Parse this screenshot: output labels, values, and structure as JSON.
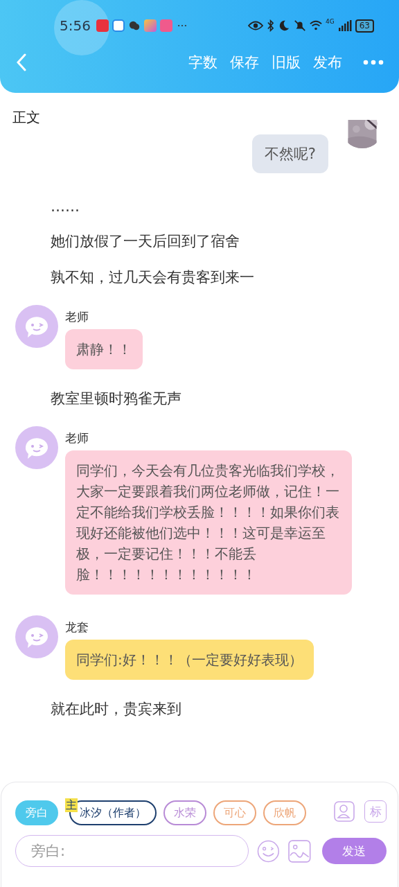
{
  "status_bar": {
    "time": "5:56",
    "network": "4G",
    "battery": "63"
  },
  "toolbar": {
    "actions": [
      "字数",
      "保存",
      "旧版",
      "发布"
    ]
  },
  "section_title": "正文",
  "blocks": [
    {
      "kind": "own_message",
      "text": "不然呢?",
      "color": "#e1e6ef"
    },
    {
      "kind": "narration",
      "text": "……"
    },
    {
      "kind": "narration",
      "text": "她们放假了一天后回到了宿舍"
    },
    {
      "kind": "narration",
      "text": "孰不知，过几天会有贵客到来一"
    },
    {
      "kind": "message",
      "name": "老师",
      "text": "肃静！！",
      "color": "#fdd0db"
    },
    {
      "kind": "narration",
      "text": "教室里顿时鸦雀无声"
    },
    {
      "kind": "message",
      "name": "老师",
      "text": "同学们，今天会有几位贵客光临我们学校，大家一定要跟着我们两位老师做，记住！一定不能给我们学校丢脸！！！！如果你们表现好还能被他们选中！！！这可是幸运至极，一定要记住！！！不能丢脸！！！！！！！！！！！！",
      "color": "#fdd0db"
    },
    {
      "kind": "message",
      "name": "龙套",
      "text": "同学们:好！！！（一定要好好表现）",
      "color": "#fddf77"
    },
    {
      "kind": "narration",
      "text": "就在此时，贵宾来到"
    }
  ],
  "roles": [
    {
      "label": "旁白",
      "selected": true,
      "color": "#4fc9ec"
    },
    {
      "label": "冰汐（作者）",
      "selected": false,
      "color": "#1e3f6e",
      "badge": "主"
    },
    {
      "label": "水荣",
      "selected": false,
      "color": "#b88bd6"
    },
    {
      "label": "可心",
      "selected": false,
      "color": "#eda679"
    },
    {
      "label": "欣帆",
      "selected": false,
      "color": "#eda679"
    }
  ],
  "tag_button": "标",
  "input": {
    "placeholder": "旁白:"
  },
  "send_button": "发送"
}
